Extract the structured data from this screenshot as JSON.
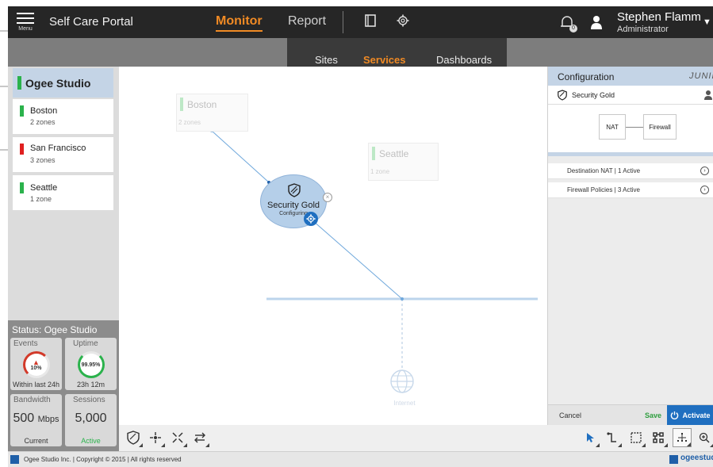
{
  "topbar": {
    "menu_label": "Menu",
    "app_title": "Self Care Portal",
    "nav": [
      "Monitor",
      "Report"
    ],
    "active_nav": "Monitor",
    "notifications_count": "0",
    "user_name": "Stephen Flamm",
    "user_role": "Administrator"
  },
  "subnav": {
    "tabs": [
      "Sites",
      "Services",
      "Dashboards"
    ],
    "active": "Services"
  },
  "sidebar": {
    "org": "Ogee Studio",
    "sites": [
      {
        "name": "Boston",
        "zones": "2 zones",
        "status_color": "#2bb24c"
      },
      {
        "name": "San Francisco",
        "zones": "3 zones",
        "status_color": "#e02020"
      },
      {
        "name": "Seattle",
        "zones": "1 zone",
        "status_color": "#2bb24c"
      }
    ]
  },
  "status": {
    "title": "Status: Ogee Studio",
    "events": {
      "label": "Events",
      "value": "10%",
      "foot": "Within last 24h"
    },
    "uptime": {
      "label": "Uptime",
      "value": "99.95%",
      "foot": "23h 12m"
    },
    "bandwidth": {
      "label": "Bandwidth",
      "value": "500",
      "unit": "Mbps",
      "foot": "Current"
    },
    "sessions": {
      "label": "Sessions",
      "value": "5,000",
      "foot": "Active"
    }
  },
  "canvas": {
    "nodes": [
      {
        "name": "Boston",
        "zones": "2 zones"
      },
      {
        "name": "Seattle",
        "zones": "1 zone"
      }
    ],
    "service": {
      "name": "Security Gold",
      "status": "Configuring"
    },
    "internet_label": "Internet"
  },
  "config_panel": {
    "title": "Configuration",
    "brand": "JUNIPER",
    "service_name": "Security Gold",
    "diagram": [
      "NAT",
      "Firewall"
    ],
    "rows": [
      "Destination NAT | 1 Active",
      "Firewall Policies | 3 Active"
    ],
    "cancel": "Cancel",
    "save": "Save",
    "activate": "Activate"
  },
  "footer": {
    "copyright": "Ogee Studio Inc. | Copyright © 2015 | All rights reserved",
    "brand": "ogeestudio"
  }
}
